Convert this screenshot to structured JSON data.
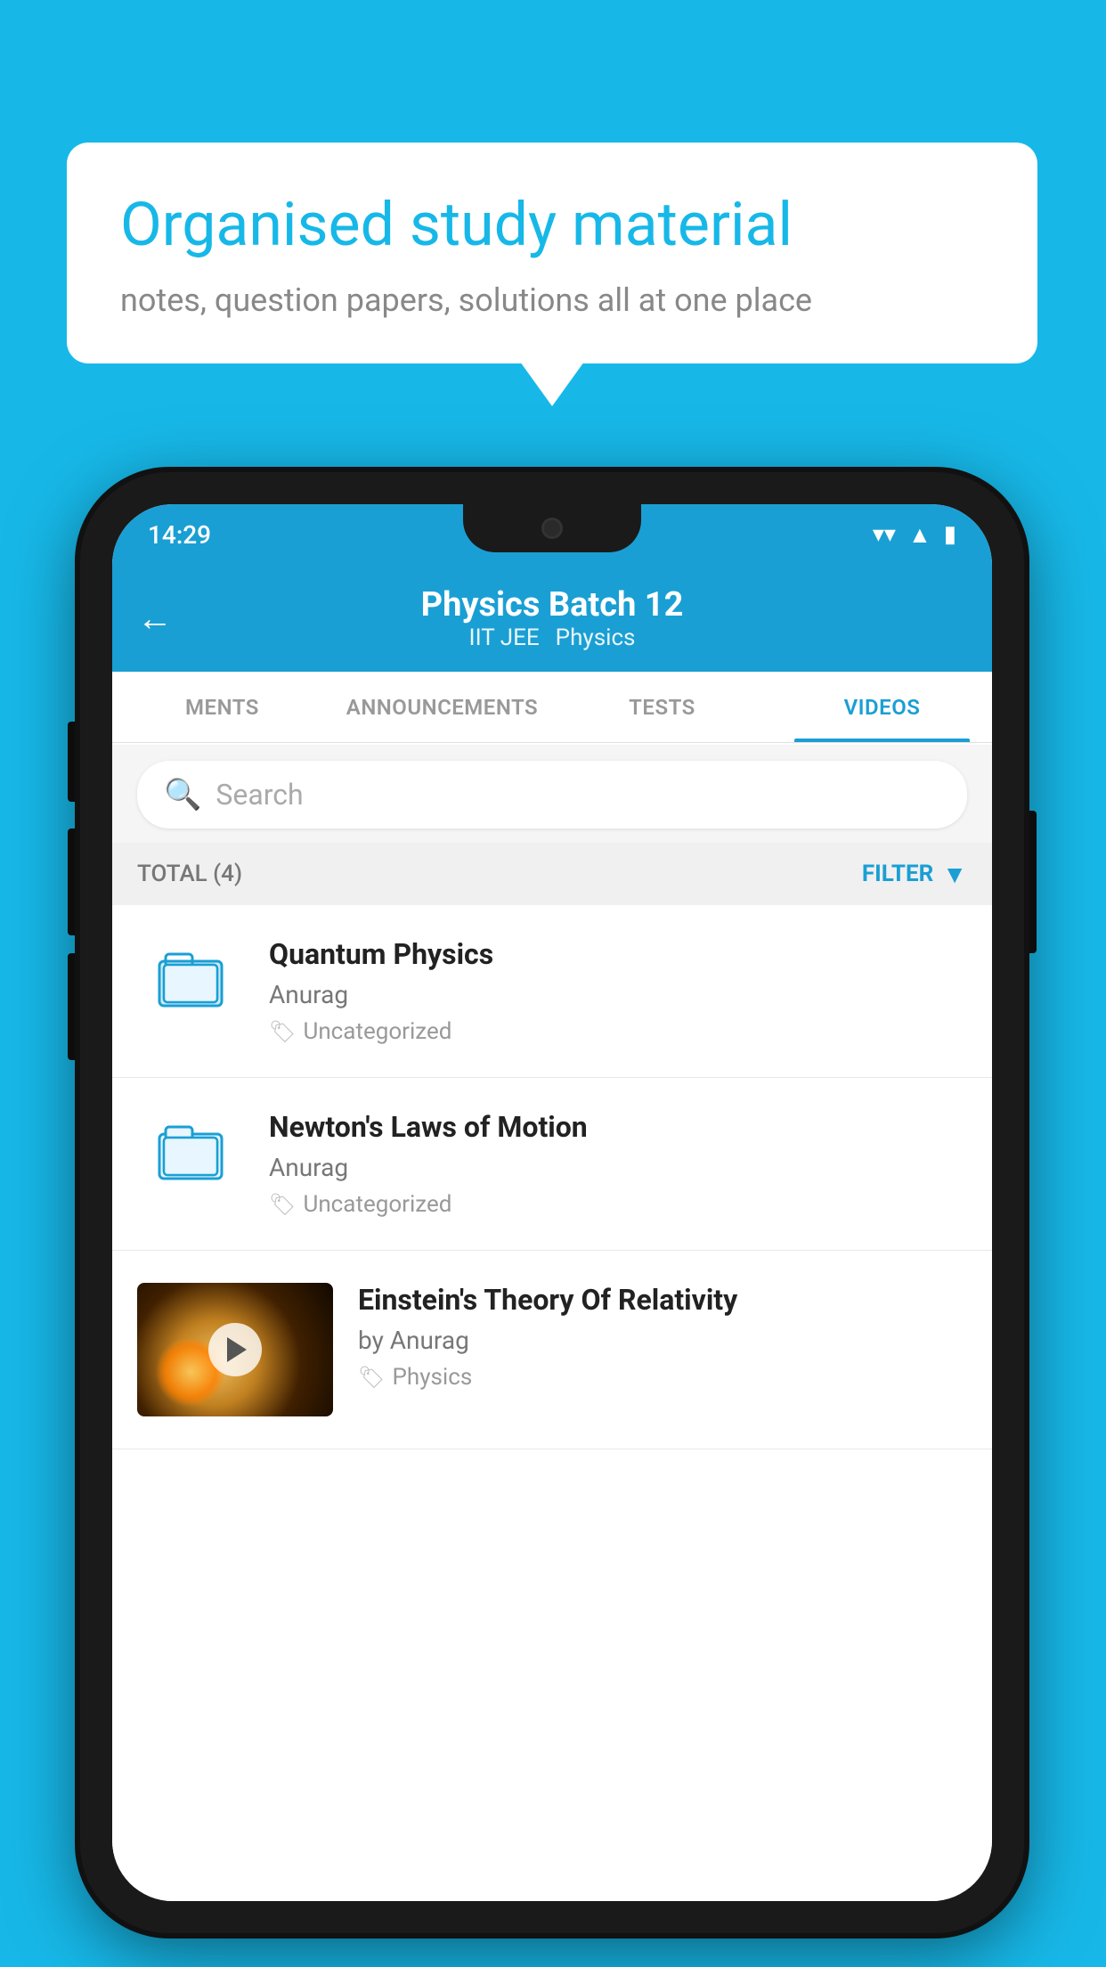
{
  "background": {
    "color": "#17b8e8"
  },
  "bubble": {
    "title": "Organised study material",
    "subtitle": "notes, question papers, solutions all at one place"
  },
  "phone": {
    "status_bar": {
      "time": "14:29"
    },
    "app_bar": {
      "title": "Physics Batch 12",
      "subtitle_left": "IIT JEE",
      "subtitle_right": "Physics",
      "back_arrow": "←"
    },
    "tabs": [
      {
        "label": "MENTS",
        "active": false
      },
      {
        "label": "ANNOUNCEMENTS",
        "active": false
      },
      {
        "label": "TESTS",
        "active": false
      },
      {
        "label": "VIDEOS",
        "active": true
      }
    ],
    "search": {
      "placeholder": "Search"
    },
    "filter_bar": {
      "total_label": "TOTAL (4)",
      "filter_label": "FILTER"
    },
    "videos": [
      {
        "title": "Quantum Physics",
        "author": "Anurag",
        "tag": "Uncategorized",
        "type": "folder"
      },
      {
        "title": "Newton's Laws of Motion",
        "author": "Anurag",
        "tag": "Uncategorized",
        "type": "folder"
      },
      {
        "title": "Einstein's Theory Of Relativity",
        "author": "by Anurag",
        "tag": "Physics",
        "type": "video"
      }
    ]
  }
}
